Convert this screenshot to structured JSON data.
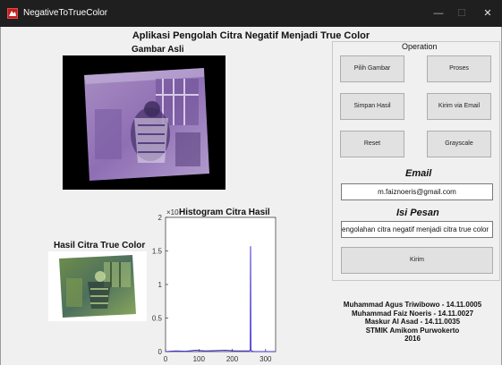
{
  "window": {
    "title": "NegativeToTrueColor",
    "minimize_glyph": "—",
    "maximize_glyph": "☐",
    "close_glyph": "✕"
  },
  "app": {
    "title": "Aplikasi Pengolah Citra Negatif Menjadi True Color"
  },
  "left": {
    "original_label": "Gambar Asli",
    "result_label": "Hasil Citra True Color"
  },
  "histogram": {
    "title": "Histogram Citra Hasil",
    "exponent_label": "×10⁴"
  },
  "operation": {
    "title": "Operation",
    "buttons": {
      "pilih": "Pilih Gambar",
      "proses": "Proses",
      "simpan": "Simpan Hasil",
      "kirim_email": "Kirim via Email",
      "reset": "Reset",
      "grayscale": "Grayscale"
    },
    "email_label": "Email",
    "email_value": "m.faiznoeris@gmail.com",
    "pesan_label": "Isi Pesan",
    "pesan_value": "engolahan citra negatif menjadi citra true color",
    "kirim": "Kirim"
  },
  "credits": [
    "Muhammad Agus Triwibowo - 14.11.0005",
    "Muhammad Faiz Noeris - 14.11.0027",
    "Maskur Al Asad - 14.11.0035",
    "STMIK Amikom Purwokerto",
    "2016"
  ],
  "colors": {
    "titlebar": "#1f1f1f",
    "window_bg": "#f0f0f0",
    "histogram_line": "#3d2fd0"
  },
  "chart_data": {
    "type": "line",
    "title": "Histogram Citra Hasil",
    "x_ticks": [
      "0",
      "100",
      "200",
      "300"
    ],
    "y_ticks": [
      "0",
      "0.5",
      "1",
      "1.5",
      "2"
    ],
    "y_multiplier": "×10⁴",
    "xlim": [
      0,
      330
    ],
    "ylim": [
      0,
      2
    ],
    "series": [
      {
        "x": [
          0,
          30,
          60,
          90,
          120,
          150,
          180,
          210,
          240,
          250,
          254,
          255,
          256,
          258,
          265,
          300,
          330
        ],
        "values": [
          0,
          0.01,
          0.005,
          0.02,
          0.01,
          0.015,
          0.02,
          0.01,
          0.01,
          0.01,
          0.02,
          1.57,
          0.03,
          0.01,
          0,
          0,
          0
        ]
      }
    ]
  }
}
